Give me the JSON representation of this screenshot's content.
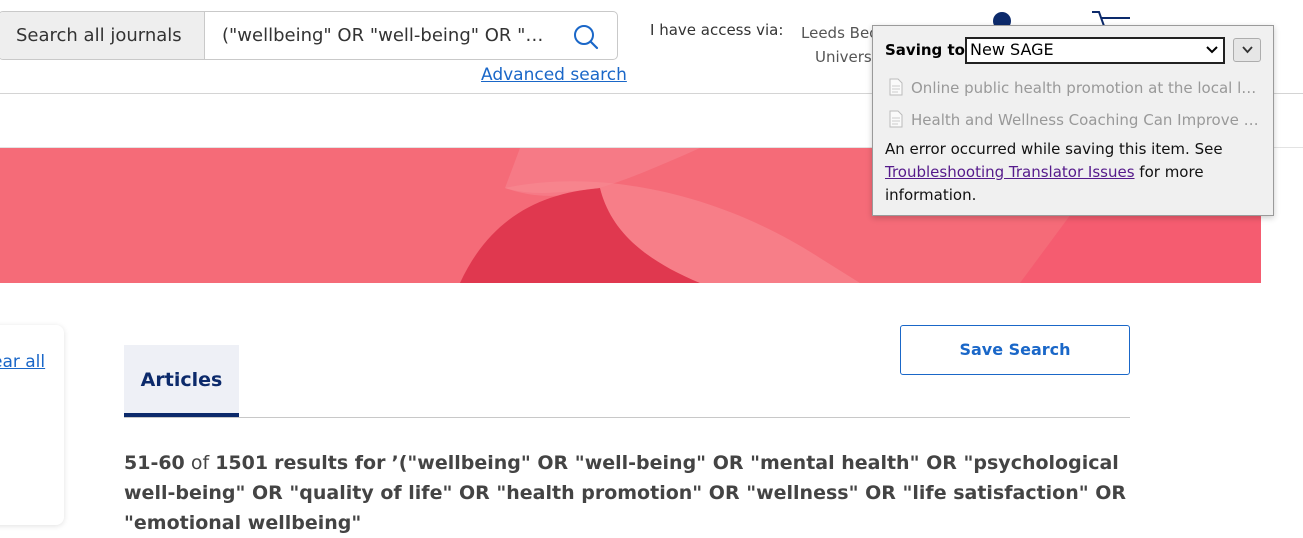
{
  "header": {
    "search_scope": "Search all journals",
    "search_query": "(\"wellbeing\" OR \"well-being\" OR \"mental health\" OR \"psychological well-being\" OR \"quality of life\"",
    "advanced_search": "Advanced search",
    "access_label": "I have access via:",
    "institution_line1": "Leeds Beck",
    "institution_line2": "Universi"
  },
  "sidebar": {
    "clear_all": "ear all"
  },
  "main": {
    "tab_articles": "Articles",
    "save_search": "Save Search",
    "results_range": "51-60",
    "results_of": "of",
    "results_total": "1501",
    "results_for": "results for",
    "results_query": "’(\"wellbeing\" OR \"well-being\" OR \"mental health\" OR \"psychological well-being\" OR \"quality of life\" OR \"health promotion\" OR \"wellness\" OR \"life satisfaction\" OR \"emotional wellbeing\""
  },
  "popup": {
    "saving_to_label": "Saving to",
    "selected_collection": "New SAGE",
    "items": [
      "Online public health promotion at the local le...",
      "Health and Wellness Coaching Can Improve T..."
    ],
    "error_prefix": "An error occurred while saving this item. See",
    "error_link": "Troubleshooting Translator Issues",
    "error_suffix": "for more information."
  },
  "colors": {
    "brand_blue": "#1a67c8",
    "navy": "#0c2a6b",
    "banner_pink": "#f56b78",
    "banner_dark": "#e0384f"
  },
  "icons": [
    "search-icon",
    "user-icon",
    "cart-icon",
    "chevron-down-icon",
    "document-icon"
  ]
}
